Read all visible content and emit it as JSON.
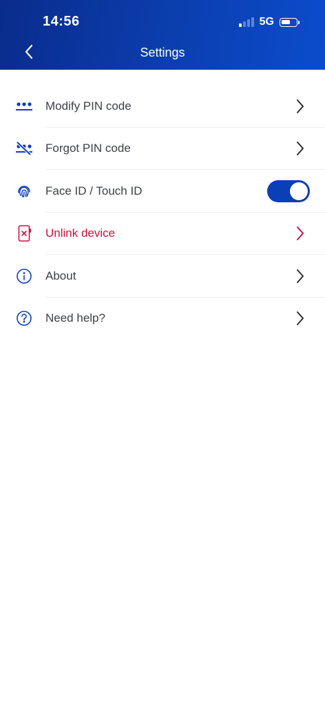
{
  "status_bar": {
    "time": "14:56",
    "network": "5G",
    "signal_bars_active": 1,
    "signal_bars_total": 4,
    "battery_level": 0.6
  },
  "header": {
    "title": "Settings",
    "back_icon": "chevron-left-icon"
  },
  "colors": {
    "brand_blue": "#0b3fb8",
    "danger_red": "#d0103a",
    "text": "#3c3f47"
  },
  "settings": {
    "items": [
      {
        "label": "Modify PIN code",
        "icon": "pin-dots-icon"
      },
      {
        "label": "Forgot PIN code",
        "icon": "pin-off-icon"
      },
      {
        "label": "Face ID / Touch ID",
        "icon": "fingerprint-icon",
        "toggle_on": true
      },
      {
        "label": "Unlink device",
        "icon": "unlink-device-icon"
      },
      {
        "label": "About",
        "icon": "info-icon"
      },
      {
        "label": "Need help?",
        "icon": "help-icon"
      }
    ]
  }
}
